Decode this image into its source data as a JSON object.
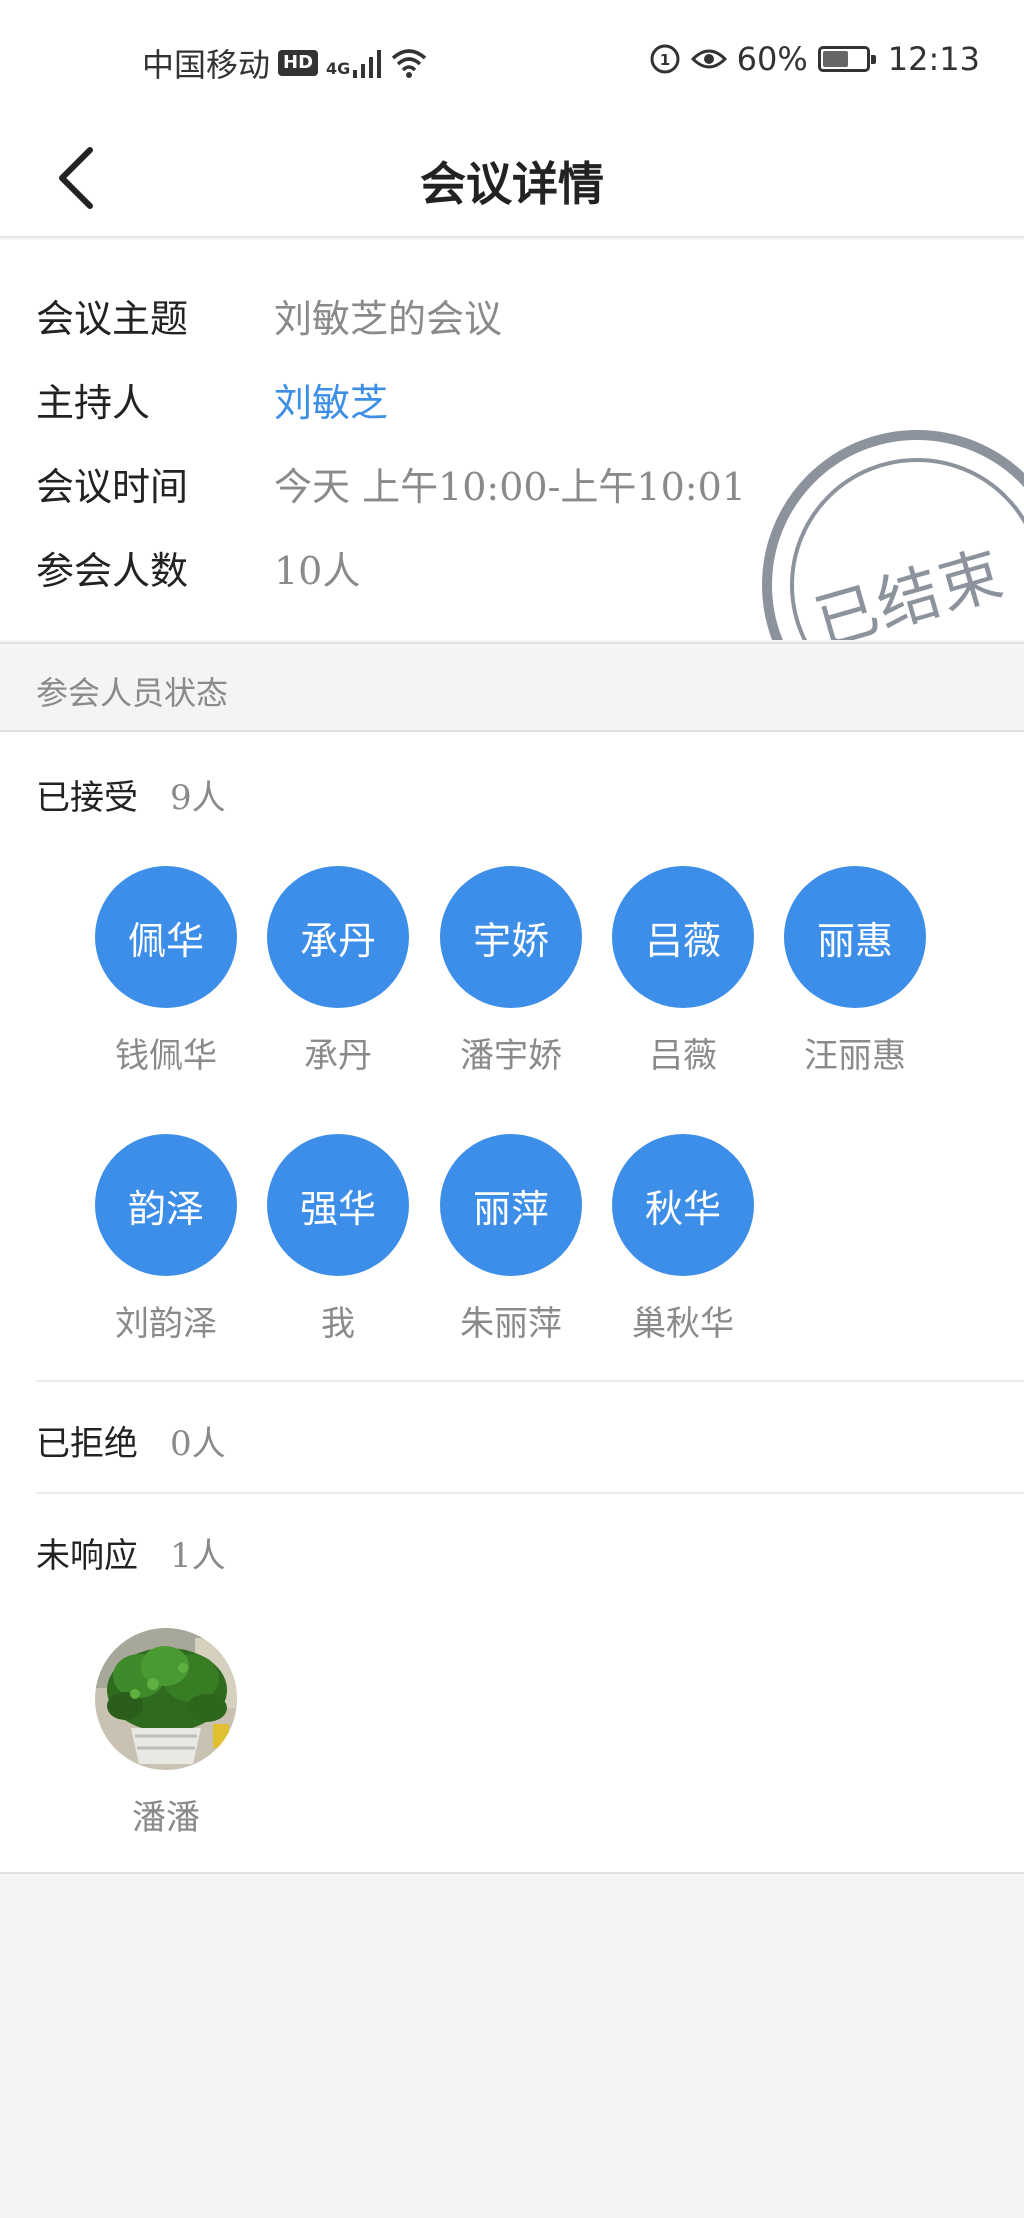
{
  "status_bar": {
    "carrier": "中国移动",
    "hd": "HD",
    "network": "4G",
    "battery": "60%",
    "battery_level": 0.6,
    "time": "12:13"
  },
  "nav": {
    "title": "会议详情",
    "back_icon": "chevron-left-icon"
  },
  "meeting": {
    "topic_label": "会议主题",
    "topic_value": "刘敏芝的会议",
    "host_label": "主持人",
    "host_value": "刘敏芝",
    "time_label": "会议时间",
    "time_value": "今天 上午10:00-上午10:01",
    "count_label": "参会人数",
    "count_value": "10人",
    "stamp": "已结束"
  },
  "section": {
    "title": "参会人员状态"
  },
  "accepted": {
    "label": "已接受",
    "count": "9人",
    "members": [
      {
        "avatar": "佩华",
        "name": "钱佩华"
      },
      {
        "avatar": "承丹",
        "name": "承丹"
      },
      {
        "avatar": "宇娇",
        "name": "潘宇娇"
      },
      {
        "avatar": "吕薇",
        "name": "吕薇"
      },
      {
        "avatar": "丽惠",
        "name": "汪丽惠"
      },
      {
        "avatar": "韵泽",
        "name": "刘韵泽"
      },
      {
        "avatar": "强华",
        "name": "我"
      },
      {
        "avatar": "丽萍",
        "name": "朱丽萍"
      },
      {
        "avatar": "秋华",
        "name": "巢秋华"
      }
    ]
  },
  "rejected": {
    "label": "已拒绝",
    "count": "0人"
  },
  "no_response": {
    "label": "未响应",
    "count": "1人",
    "members": [
      {
        "name": "潘潘",
        "avatar_image": "plant-photo"
      }
    ]
  },
  "colors": {
    "accent": "#3d8ee8",
    "stamp": "#8c939c",
    "secondary_text": "#8a8a8a"
  }
}
